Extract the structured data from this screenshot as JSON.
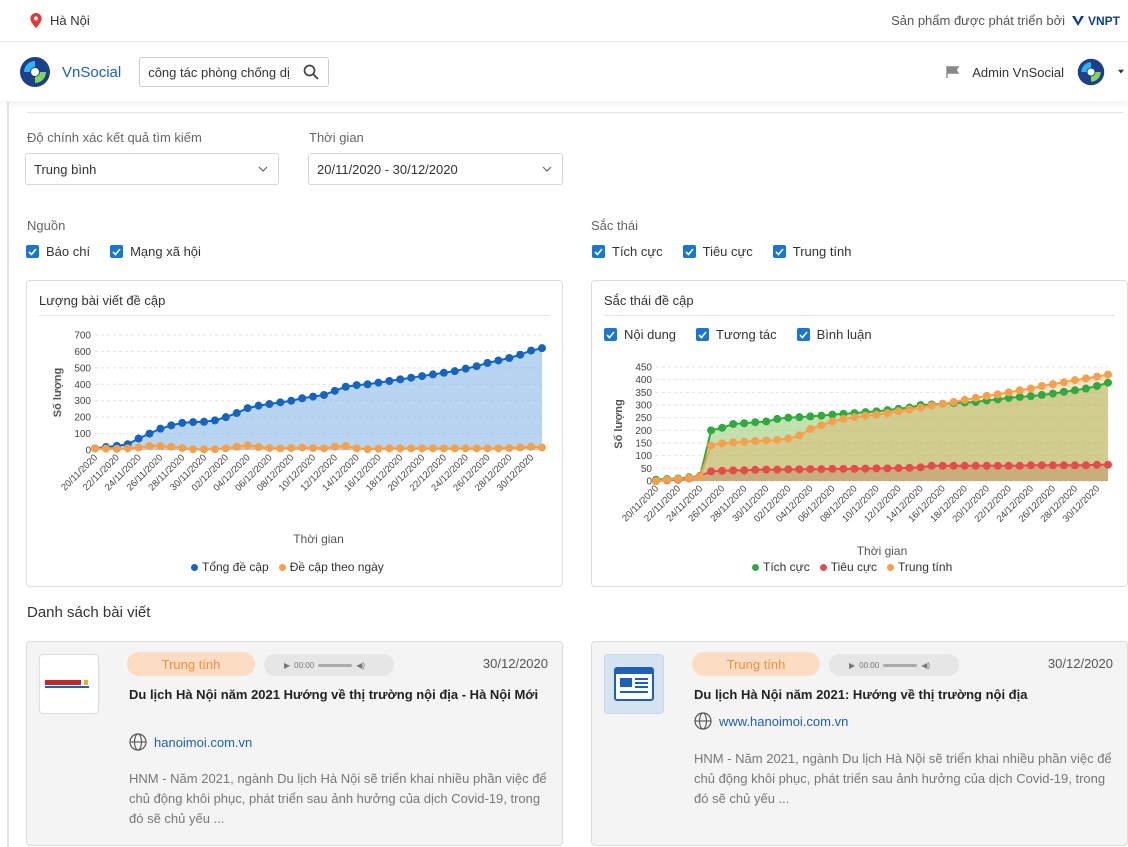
{
  "topbar": {
    "location": "Hà Nội",
    "developed_by": "Sản phẩm được phát triển bởi",
    "vnpt": "VNPT"
  },
  "navbar": {
    "brand": "VnSocial",
    "search_value": "công tác phòng chống dị",
    "user": "Admin VnSocial"
  },
  "filters": {
    "accuracy_label": "Độ chính xác kết quả tìm kiếm",
    "accuracy_value": "Trung bình",
    "time_label": "Thời gian",
    "time_value": "20/11/2020 - 30/12/2020",
    "source_label": "Nguồn",
    "sources": [
      "Báo chí",
      "Mạng xã hội"
    ],
    "sentiment_label": "Sắc thái",
    "sentiments": [
      "Tích cực",
      "Tiêu cực",
      "Trung tính"
    ]
  },
  "chart_left_title": "Lượng bài viết đề cập",
  "chart_right_title": "Sắc thái đề cập",
  "chart_right_filters": [
    "Nội dung",
    "Tương tác",
    "Bình luận"
  ],
  "colors": {
    "blue": "#1565c0",
    "orange": "#f5a04a",
    "green": "#2eaa3f",
    "red": "#e54b4b",
    "brand": "#1e5fb8"
  },
  "chart_data": [
    {
      "type": "area",
      "xlabel": "Thời gian",
      "ylabel": "Số lượng",
      "ylim": [
        0,
        700
      ],
      "yticks": [
        0,
        100,
        200,
        300,
        400,
        500,
        600,
        700
      ],
      "xtick_labels": [
        "20/11/2020",
        "22/11/2020",
        "24/11/2020",
        "26/11/2020",
        "28/11/2020",
        "30/11/2020",
        "02/12/2020",
        "04/12/2020",
        "06/12/2020",
        "08/12/2020",
        "10/12/2020",
        "12/12/2020",
        "14/12/2020",
        "16/12/2020",
        "18/12/2020",
        "20/12/2020",
        "22/12/2020",
        "24/12/2020",
        "26/12/2020",
        "28/12/2020",
        "30/12/2020"
      ],
      "x_count": 41,
      "series": [
        {
          "name": "Tổng đề cập",
          "values": [
            10,
            18,
            25,
            35,
            70,
            100,
            130,
            150,
            165,
            170,
            172,
            180,
            200,
            225,
            255,
            270,
            280,
            290,
            300,
            315,
            325,
            335,
            360,
            385,
            395,
            400,
            410,
            420,
            430,
            440,
            450,
            460,
            470,
            480,
            495,
            510,
            530,
            545,
            560,
            580,
            605,
            620
          ]
        },
        {
          "name": "Đề cập theo ngày",
          "values": [
            10,
            8,
            7,
            10,
            15,
            25,
            25,
            20,
            12,
            5,
            4,
            5,
            10,
            20,
            28,
            18,
            12,
            10,
            12,
            15,
            12,
            10,
            20,
            25,
            10,
            5,
            8,
            10,
            10,
            10,
            10,
            10,
            10,
            10,
            10,
            10,
            10,
            10,
            12,
            15,
            20,
            15
          ]
        }
      ]
    },
    {
      "type": "area",
      "xlabel": "Thời gian",
      "ylabel": "Số lượng",
      "ylim": [
        0,
        450
      ],
      "yticks": [
        0,
        50,
        100,
        150,
        200,
        250,
        300,
        350,
        400,
        450
      ],
      "xtick_labels": [
        "20/11/2020",
        "22/11/2020",
        "24/11/2020",
        "26/11/2020",
        "28/11/2020",
        "30/11/2020",
        "02/12/2020",
        "04/12/2020",
        "06/12/2020",
        "08/12/2020",
        "10/12/2020",
        "12/12/2020",
        "14/12/2020",
        "16/12/2020",
        "18/12/2020",
        "20/12/2020",
        "22/12/2020",
        "24/12/2020",
        "26/12/2020",
        "28/12/2020",
        "30/12/2020"
      ],
      "series": [
        {
          "name": "Tích cực",
          "values": [
            5,
            8,
            10,
            15,
            20,
            200,
            210,
            225,
            228,
            232,
            235,
            245,
            250,
            252,
            255,
            258,
            262,
            265,
            268,
            272,
            275,
            280,
            285,
            290,
            300,
            302,
            305,
            308,
            310,
            312,
            318,
            322,
            328,
            332,
            335,
            340,
            345,
            352,
            358,
            365,
            375,
            388
          ]
        },
        {
          "name": "Tiêu cực",
          "values": [
            0,
            3,
            5,
            10,
            20,
            38,
            40,
            42,
            42,
            44,
            45,
            45,
            46,
            46,
            47,
            47,
            48,
            48,
            48,
            49,
            50,
            50,
            51,
            52,
            54,
            60,
            60,
            60,
            60,
            60,
            60,
            60,
            60,
            60,
            62,
            62,
            62,
            62,
            62,
            62,
            64,
            64
          ]
        },
        {
          "name": "Trung tính",
          "values": [
            0,
            5,
            8,
            12,
            18,
            140,
            148,
            152,
            155,
            158,
            160,
            162,
            168,
            180,
            205,
            220,
            235,
            245,
            252,
            258,
            262,
            268,
            275,
            282,
            290,
            298,
            305,
            312,
            320,
            328,
            336,
            342,
            350,
            358,
            365,
            375,
            382,
            390,
            398,
            405,
            412,
            420
          ]
        }
      ]
    }
  ],
  "articles": [
    {
      "badge": "Trung tính",
      "audio_time": "00:00",
      "date": "30/12/2020",
      "title": "Du lịch Hà Nội năm 2021 Hướng về thị trường nội địa - Hà Nội Mới",
      "source": "hanoimoi.com.vn",
      "desc": "HNM - Năm 2021, ngành Du lịch Hà Nội sẽ triển khai nhiều phần việc để chủ động khôi phục, phát triển sau ảnh hưởng của dịch Covid-19, trong đó sẽ chủ yếu ..."
    },
    {
      "badge": "Trung tính",
      "audio_time": "00:00",
      "date": "30/12/2020",
      "title": "Du lịch Hà Nội năm 2021: Hướng về thị trường nội địa",
      "source": "www.hanoimoi.com.vn",
      "desc": "HNM - Năm 2021, ngành Du lịch Hà Nội sẽ triển khai nhiều phần việc để chủ động khôi phục, phát triển sau ảnh hưởng của dịch Covid-19, trong đó sẽ chủ yếu ..."
    }
  ],
  "section_title": "Danh sách bài viết"
}
